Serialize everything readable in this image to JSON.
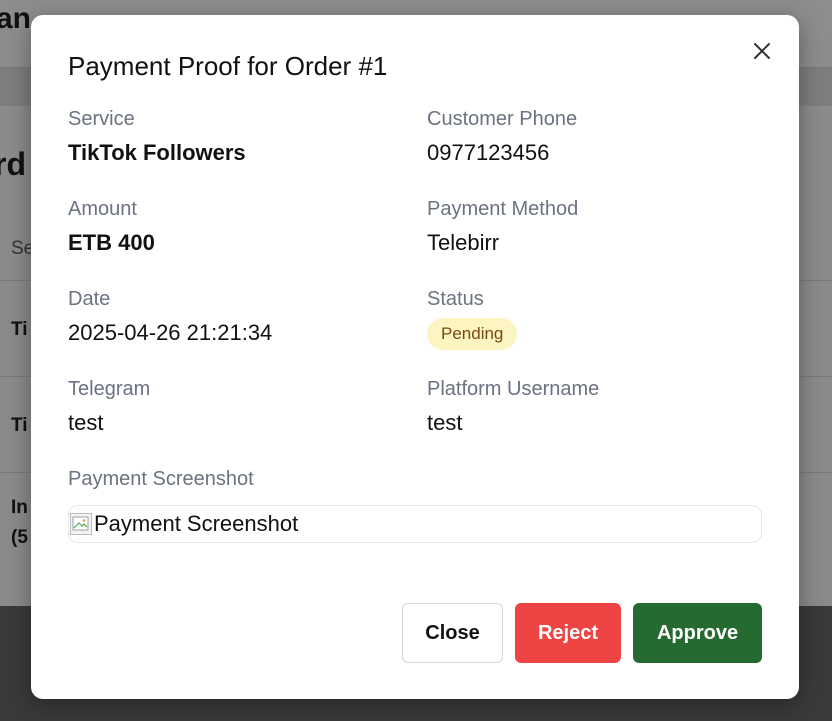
{
  "background": {
    "header_title": "an",
    "page_heading": "rd",
    "column_header": "Se",
    "rows": [
      "Ti",
      "Ti",
      "In",
      "(5"
    ]
  },
  "modal": {
    "title": "Payment Proof for Order #1",
    "close_icon": "close-icon",
    "fields": {
      "service": {
        "label": "Service",
        "value": "TikTok Followers"
      },
      "customer_phone": {
        "label": "Customer Phone",
        "value": "0977123456"
      },
      "amount": {
        "label": "Amount",
        "value": "ETB 400"
      },
      "payment_method": {
        "label": "Payment Method",
        "value": "Telebirr"
      },
      "date": {
        "label": "Date",
        "value": "2025-04-26 21:21:34"
      },
      "status": {
        "label": "Status",
        "value": "Pending"
      },
      "telegram": {
        "label": "Telegram",
        "value": "test"
      },
      "platform_username": {
        "label": "Platform Username",
        "value": "test"
      }
    },
    "screenshot": {
      "label": "Payment Screenshot",
      "alt": "Payment Screenshot"
    },
    "buttons": {
      "close": "Close",
      "reject": "Reject",
      "approve": "Approve"
    }
  },
  "colors": {
    "approve": "#256b31",
    "reject": "#ef4444",
    "pending_bg": "#fdf5c1",
    "pending_text": "#7a4a12"
  }
}
